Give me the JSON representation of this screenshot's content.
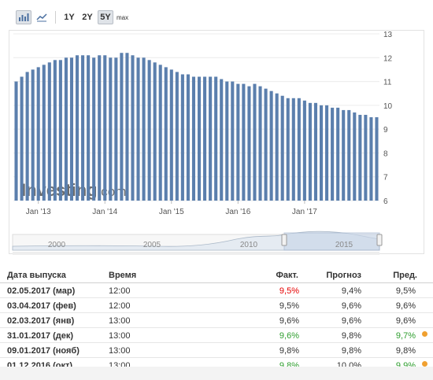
{
  "toolbar": {
    "bar_chart_icon": "bar-chart-icon",
    "line_chart_icon": "line-chart-icon",
    "ranges": [
      "1Y",
      "2Y",
      "5Y"
    ],
    "active_range": "5Y",
    "max_label": "max"
  },
  "chart_data": {
    "type": "bar",
    "color": "#5b7fad",
    "yaxis": {
      "min": 6,
      "max": 13,
      "ticks": [
        "13",
        "12",
        "11",
        "10",
        "9",
        "8",
        "7",
        "6"
      ],
      "position": "right"
    },
    "xaxis": {
      "tick_labels": [
        "Jan '13",
        "Jan '14",
        "Jan '15",
        "Jan '16",
        "Jan '17"
      ]
    },
    "values": [
      11.0,
      11.2,
      11.4,
      11.5,
      11.6,
      11.7,
      11.8,
      11.9,
      11.9,
      12.0,
      12.0,
      12.1,
      12.1,
      12.1,
      12.0,
      12.1,
      12.1,
      12.0,
      12.0,
      12.2,
      12.2,
      12.1,
      12.0,
      12.0,
      11.9,
      11.8,
      11.7,
      11.6,
      11.5,
      11.4,
      11.3,
      11.3,
      11.2,
      11.2,
      11.2,
      11.2,
      11.2,
      11.1,
      11.0,
      11.0,
      10.9,
      10.9,
      10.8,
      10.9,
      10.8,
      10.7,
      10.6,
      10.5,
      10.4,
      10.3,
      10.3,
      10.3,
      10.2,
      10.1,
      10.1,
      10.0,
      10.0,
      9.9,
      9.9,
      9.8,
      9.8,
      9.7,
      9.6,
      9.6,
      9.5,
      9.5
    ],
    "watermark": "Investing.com",
    "navigator": {
      "labels": [
        "2000",
        "2005",
        "2010",
        "2015"
      ]
    }
  },
  "table": {
    "headers": {
      "date": "Дата выпуска",
      "time": "Время",
      "actual": "Факт.",
      "forecast": "Прогноз",
      "previous": "Пред."
    },
    "rows": [
      {
        "date": "02.05.2017 (мар)",
        "time": "12:00",
        "actual": "9,5%",
        "forecast": "9,4%",
        "previous": "9,5%",
        "actual_color": "red",
        "prev_color": "",
        "dot": false
      },
      {
        "date": "03.04.2017 (фев)",
        "time": "12:00",
        "actual": "9,5%",
        "forecast": "9,6%",
        "previous": "9,6%",
        "actual_color": "",
        "prev_color": "",
        "dot": false
      },
      {
        "date": "02.03.2017 (янв)",
        "time": "13:00",
        "actual": "9,6%",
        "forecast": "9,6%",
        "previous": "9,6%",
        "actual_color": "",
        "prev_color": "",
        "dot": false
      },
      {
        "date": "31.01.2017 (дек)",
        "time": "13:00",
        "actual": "9,6%",
        "forecast": "9,8%",
        "previous": "9,7%",
        "actual_color": "green",
        "prev_color": "green",
        "dot": true
      },
      {
        "date": "09.01.2017 (нояб)",
        "time": "13:00",
        "actual": "9,8%",
        "forecast": "9,8%",
        "previous": "9,8%",
        "actual_color": "",
        "prev_color": "",
        "dot": false
      },
      {
        "date": "01.12.2016 (окт)",
        "time": "13:00",
        "actual": "9,8%",
        "forecast": "10,0%",
        "previous": "9,9%",
        "actual_color": "green",
        "prev_color": "green",
        "dot": true
      }
    ]
  }
}
